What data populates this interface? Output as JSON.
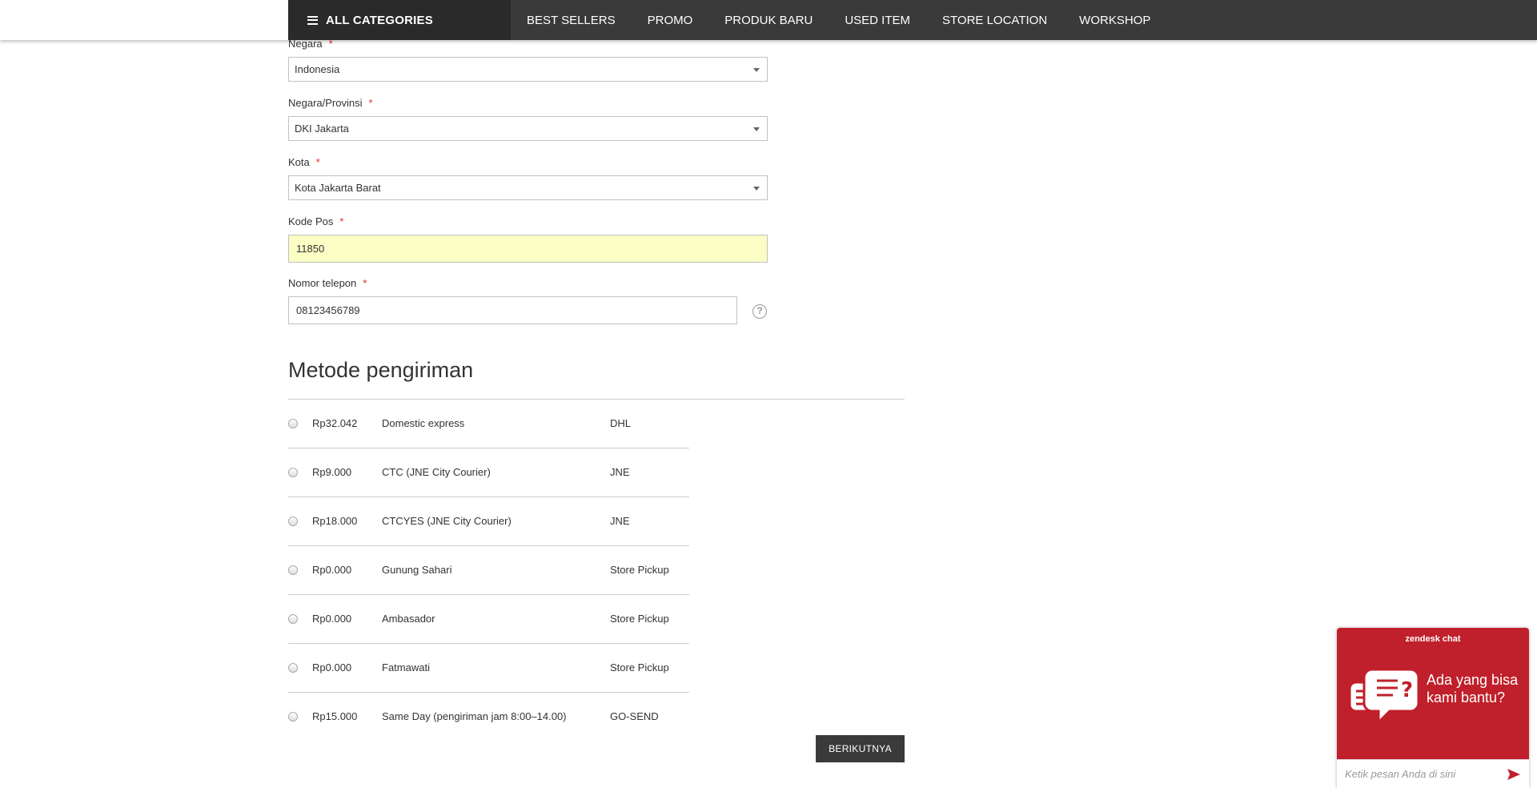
{
  "nav": {
    "all_categories": "ALL CATEGORIES",
    "links": [
      "BEST SELLERS",
      "PROMO",
      "PRODUK BARU",
      "USED ITEM",
      "STORE LOCATION",
      "WORKSHOP"
    ]
  },
  "form": {
    "country": {
      "label": "Negara",
      "value": "Indonesia"
    },
    "province": {
      "label": "Negara/Provinsi",
      "value": "DKI Jakarta"
    },
    "city": {
      "label": "Kota",
      "value": "Kota Jakarta Barat"
    },
    "postcode": {
      "label": "Kode Pos",
      "value": "11850"
    },
    "phone": {
      "label": "Nomor telepon",
      "value": "08123456789",
      "help_icon": "question-icon"
    },
    "required_mark": "*"
  },
  "shipping": {
    "title": "Metode pengiriman",
    "methods": [
      {
        "price": "Rp32.042",
        "method": "Domestic express",
        "carrier": "DHL"
      },
      {
        "price": "Rp9.000",
        "method": "CTC (JNE City Courier)",
        "carrier": "JNE"
      },
      {
        "price": "Rp18.000",
        "method": "CTCYES (JNE City Courier)",
        "carrier": "JNE"
      },
      {
        "price": "Rp0.000",
        "method": "Gunung Sahari",
        "carrier": "Store Pickup"
      },
      {
        "price": "Rp0.000",
        "method": "Ambasador",
        "carrier": "Store Pickup"
      },
      {
        "price": "Rp0.000",
        "method": "Fatmawati",
        "carrier": "Store Pickup"
      },
      {
        "price": "Rp15.000",
        "method": "Same Day (pengiriman jam 8:00–14.00)",
        "carrier": "GO-SEND"
      }
    ],
    "next_button": "BERIKUTNYA"
  },
  "chat": {
    "brand": "zendesk chat",
    "prompt": "Ada yang bisa kami bantu?",
    "input_placeholder": "Ketik pesan Anda di sini",
    "colors": {
      "background": "#c0202b"
    }
  }
}
